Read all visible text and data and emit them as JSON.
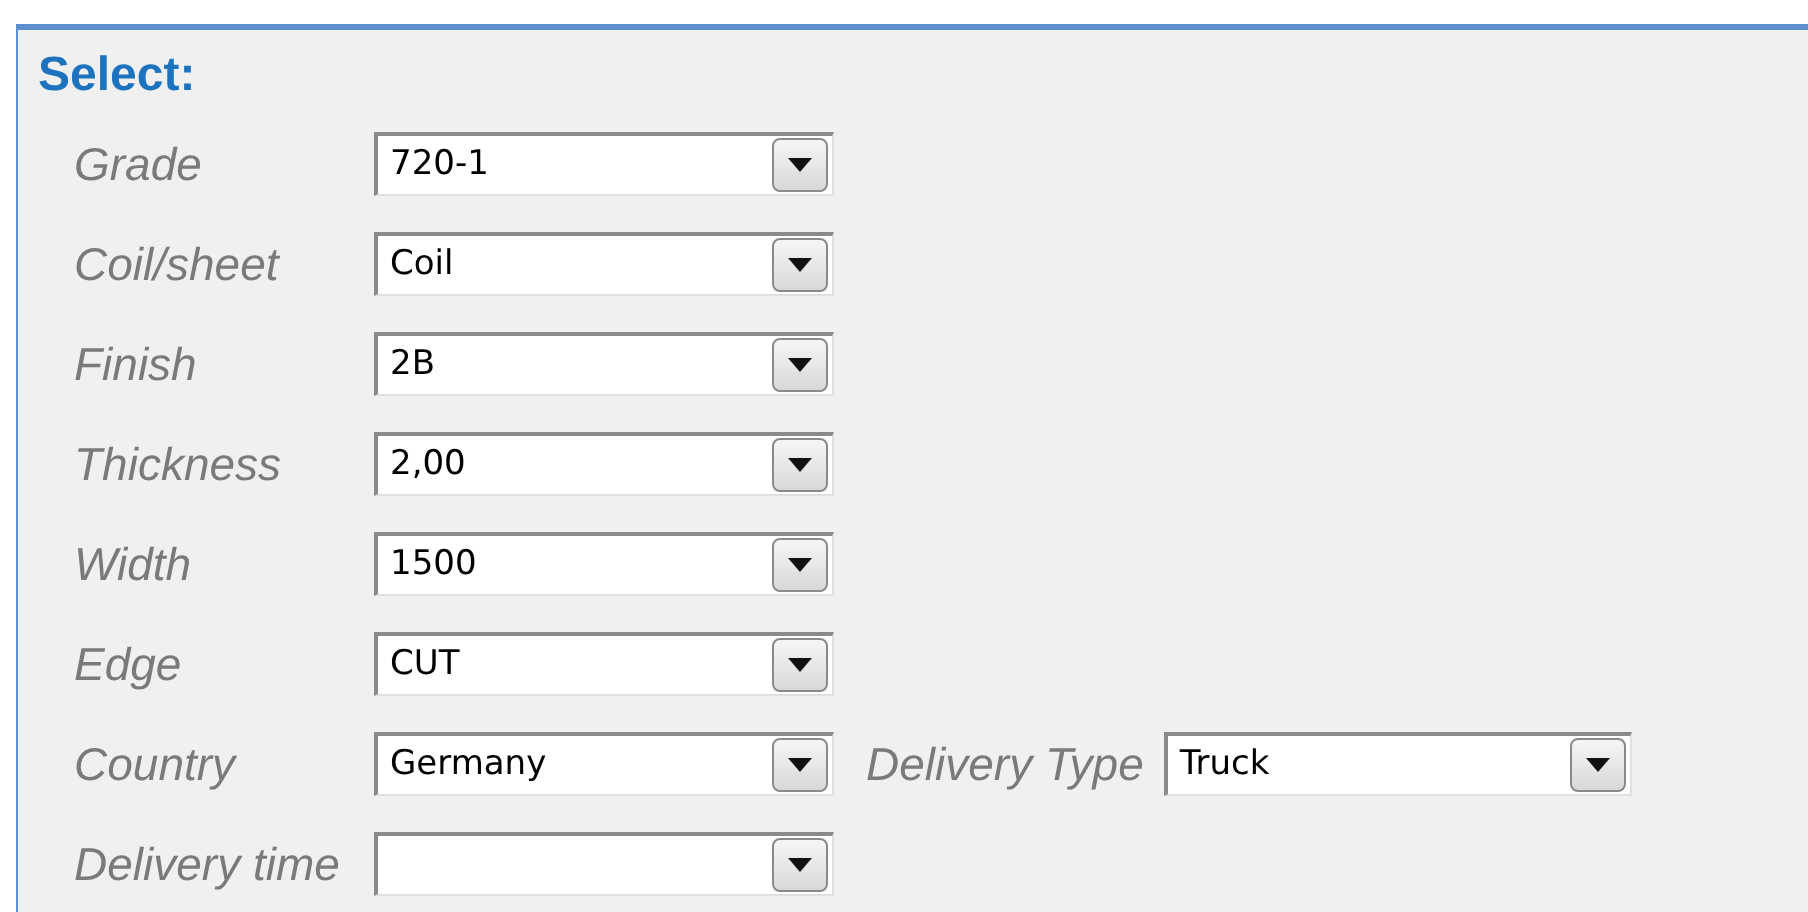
{
  "heading": "Select:",
  "fields": [
    {
      "label": "Grade",
      "value": "720-1"
    },
    {
      "label": "Coil/sheet",
      "value": "Coil"
    },
    {
      "label": "Finish",
      "value": "2B"
    },
    {
      "label": "Thickness",
      "value": "2,00"
    },
    {
      "label": "Width",
      "value": "1500"
    },
    {
      "label": "Edge",
      "value": "CUT"
    },
    {
      "label": "Country",
      "value": "Germany",
      "extra": {
        "label": "Delivery Type",
        "value": "Truck"
      }
    },
    {
      "label": "Delivery time"
    }
  ]
}
